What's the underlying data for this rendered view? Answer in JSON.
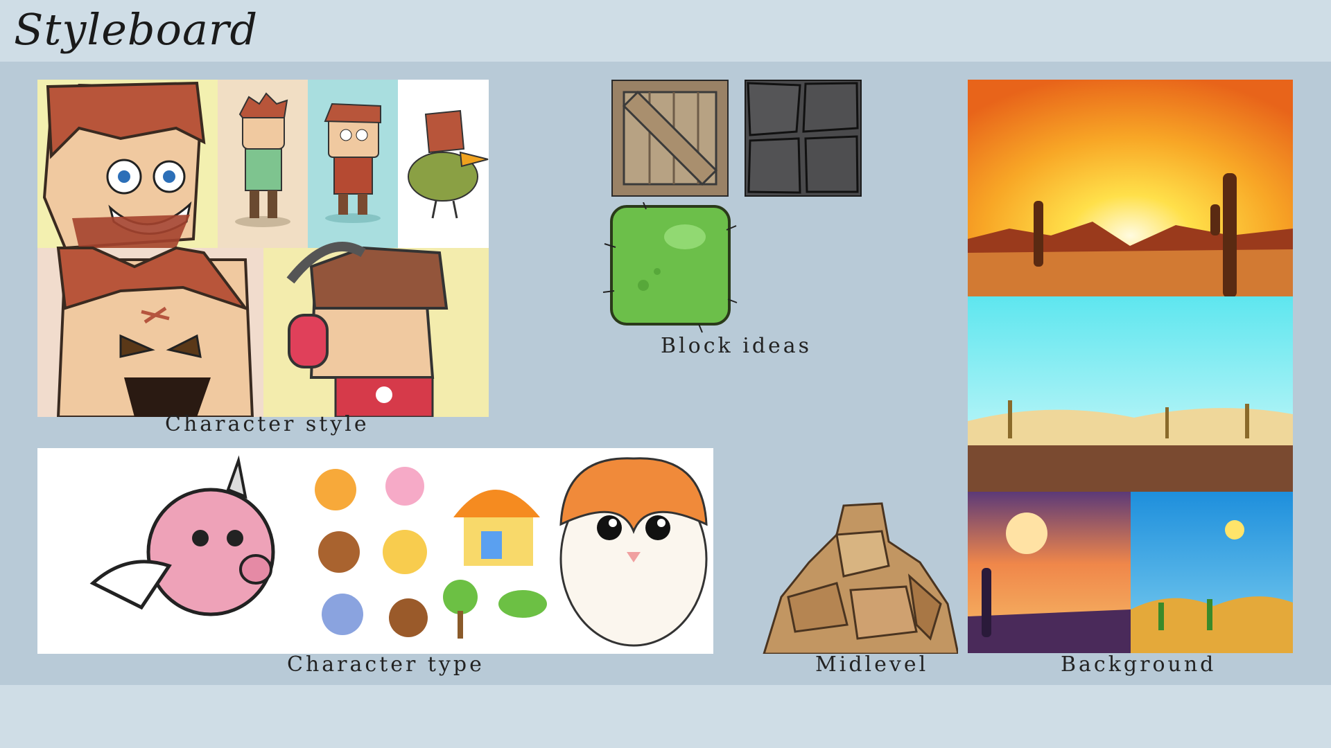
{
  "page": {
    "title": "Styleboard"
  },
  "captions": {
    "character_style": "Character style",
    "block_ideas": "Block ideas",
    "character_type": "Character type",
    "midlevel": "Midlevel",
    "background": "Background"
  },
  "colors": {
    "board": "#b8cad7",
    "header": "#cfdde6",
    "hair": "#b8553a",
    "skin": "#f0c9a0",
    "crate": "#9a8266",
    "stone": "#4a4a4c",
    "grass": "#6cbf4a",
    "sun": "#ffd21f",
    "sky": "#8fe8f4",
    "sand": "#e6c27a"
  }
}
